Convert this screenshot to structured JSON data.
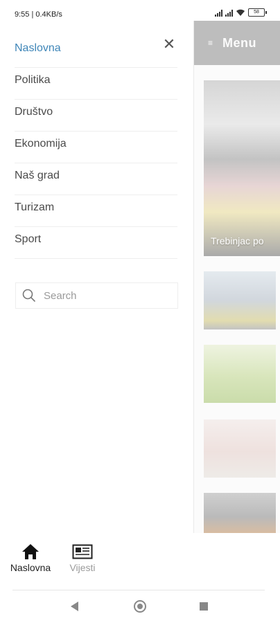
{
  "status": {
    "time_net": "9:55 | 0.4KB/s",
    "battery": "58"
  },
  "background": {
    "menu_label": "Menu",
    "feature_caption": "Trebinjac po"
  },
  "drawer": {
    "items": [
      {
        "label": "Naslovna",
        "active": true
      },
      {
        "label": "Politika"
      },
      {
        "label": "Društvo"
      },
      {
        "label": "Ekonomija"
      },
      {
        "label": "Naš grad"
      },
      {
        "label": "Turizam"
      },
      {
        "label": "Sport"
      }
    ],
    "close_icon": "close-icon",
    "search_placeholder": "Search"
  },
  "bottom_nav": {
    "home_label": "Naslovna",
    "news_label": "Vijesti"
  },
  "colors": {
    "active": "#3f86b8",
    "menubar": "#bdbdbd"
  }
}
